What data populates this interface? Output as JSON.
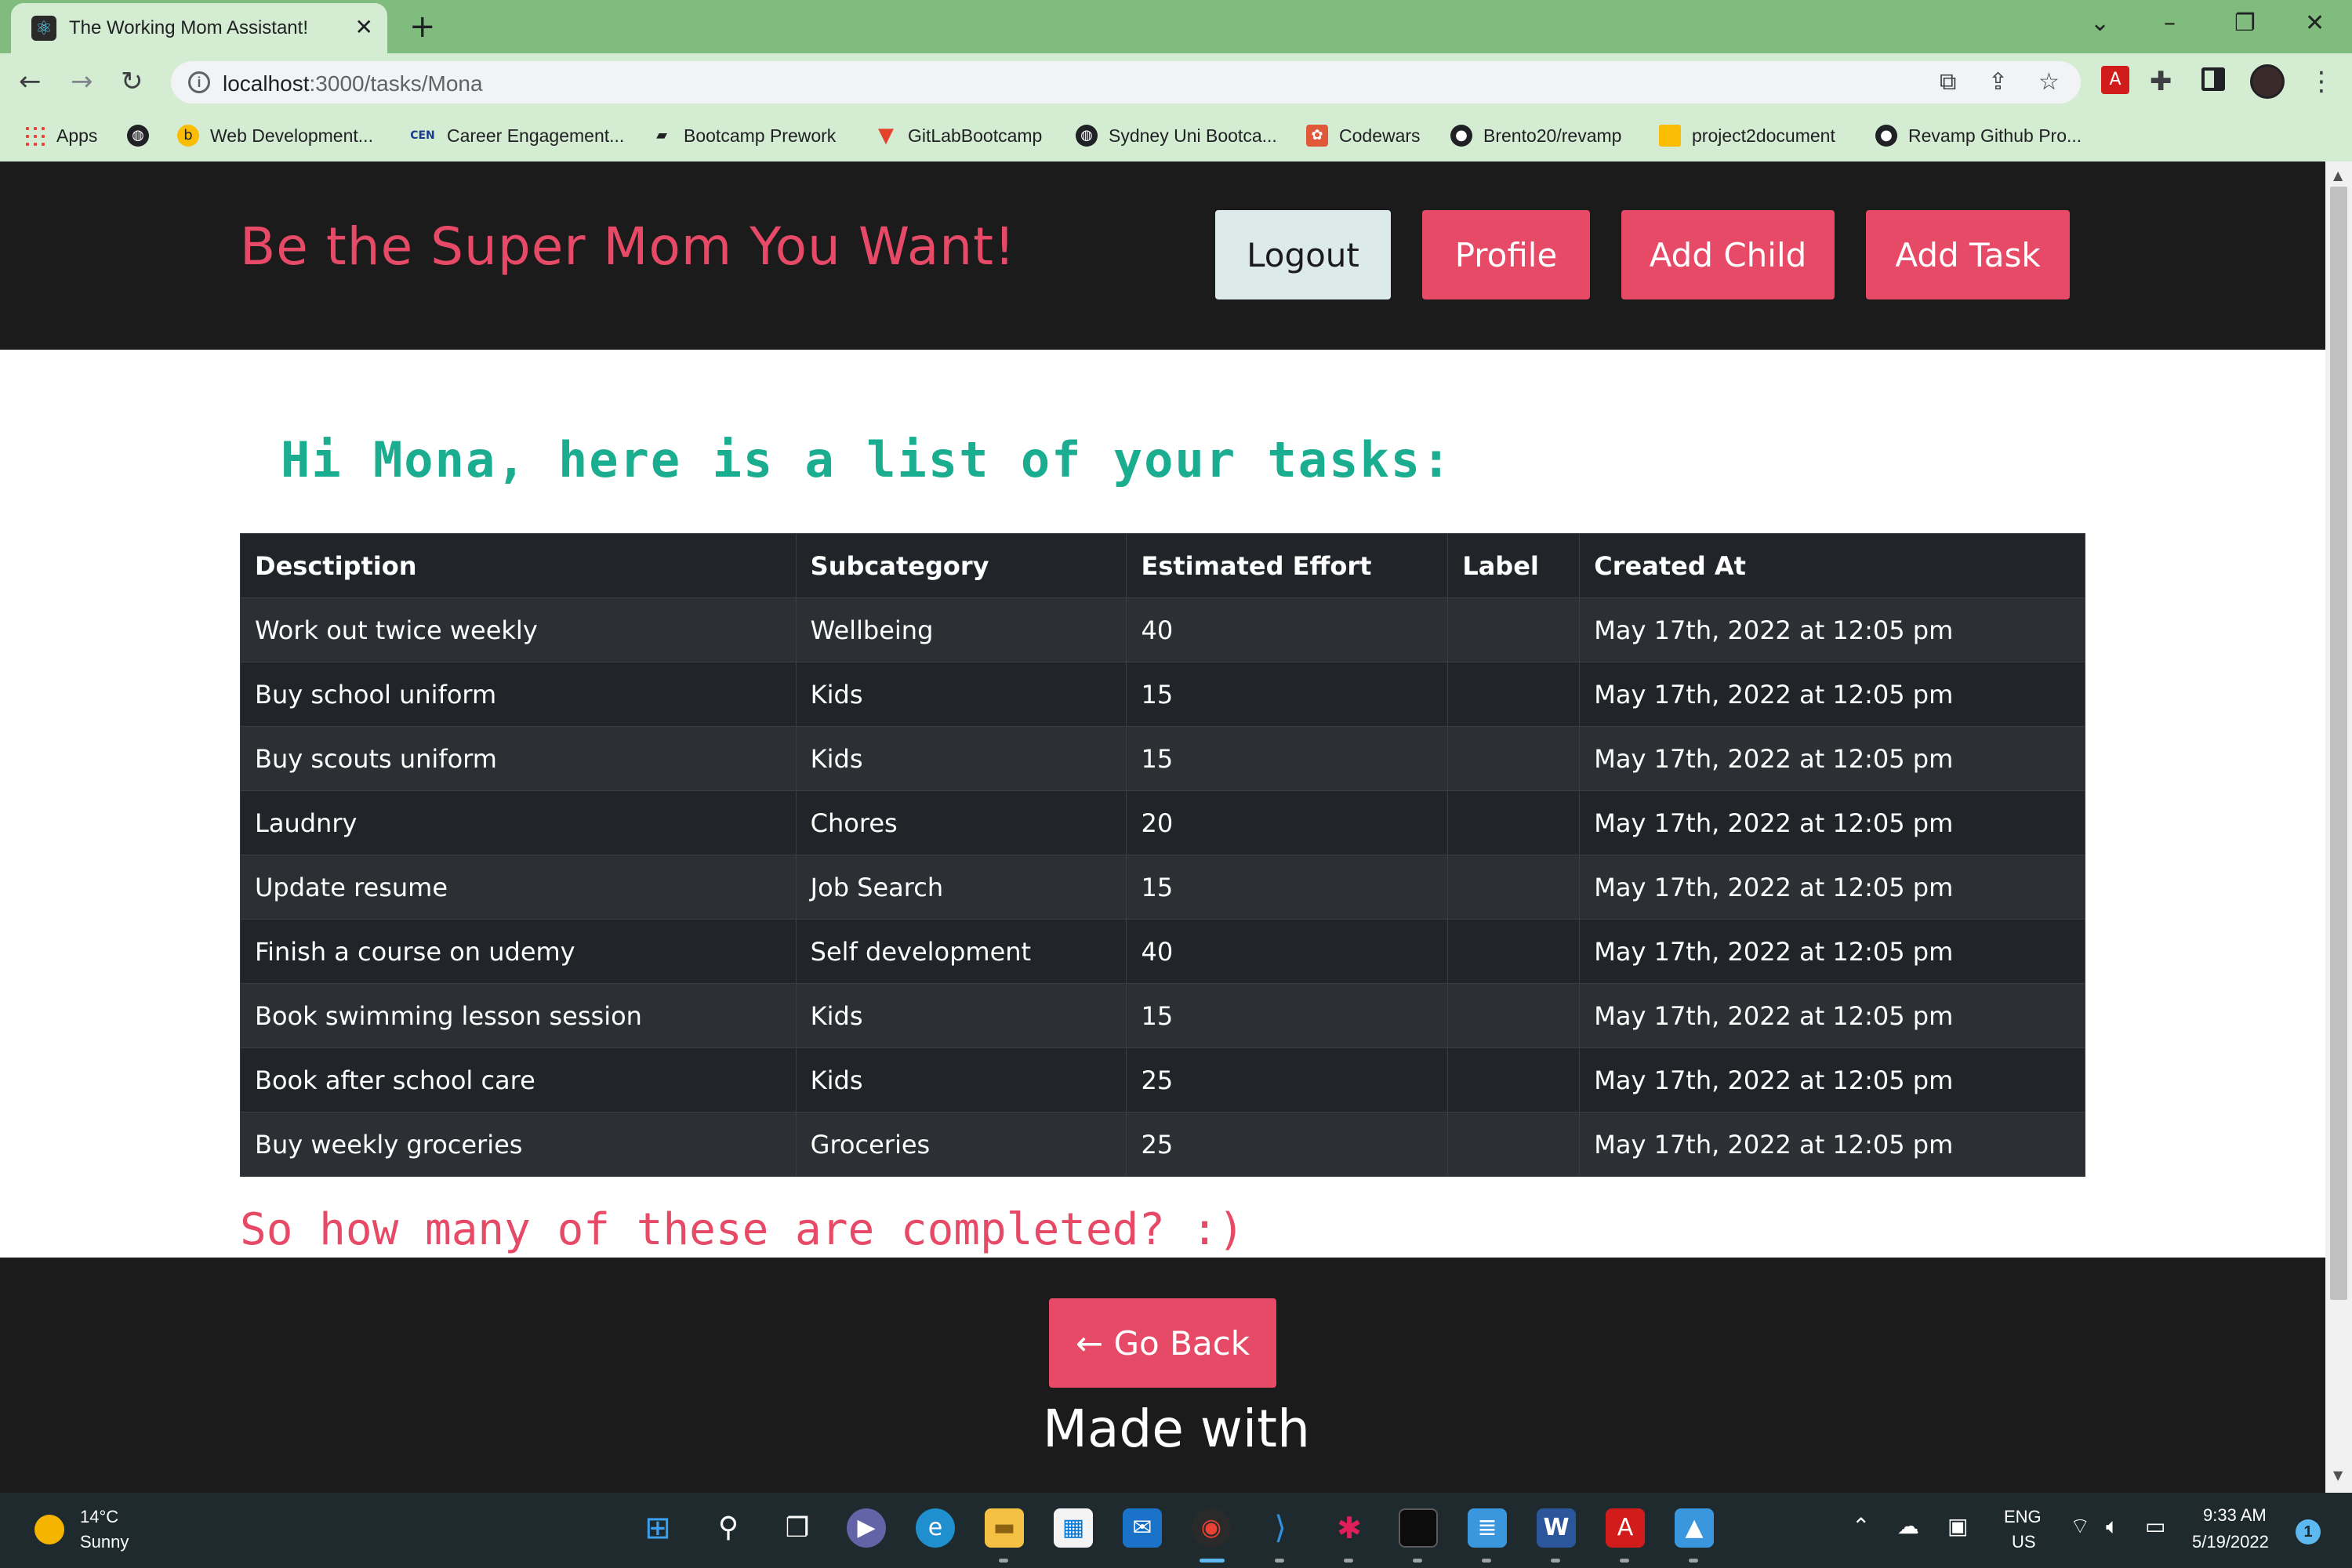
{
  "browser": {
    "tab_title": "The Working Mom Assistant!",
    "url_host": "localhost",
    "url_path": ":3000/tasks/Mona",
    "bookmarks": [
      {
        "label": "Apps"
      },
      {
        "label": ""
      },
      {
        "label": "Web Development..."
      },
      {
        "label": "Career Engagement..."
      },
      {
        "label": "Bootcamp Prework"
      },
      {
        "label": "GitLabBootcamp"
      },
      {
        "label": "Sydney Uni Bootca..."
      },
      {
        "label": "Codewars"
      },
      {
        "label": "Brento20/revamp"
      },
      {
        "label": "project2document"
      },
      {
        "label": "Revamp Github Pro..."
      }
    ]
  },
  "header": {
    "title": "Be the Super Mom You Want!",
    "buttons": {
      "logout": "Logout",
      "profile": "Profile",
      "add_child": "Add Child",
      "add_task": "Add Task"
    }
  },
  "main": {
    "greeting": "Hi Mona, here is a list of your tasks:",
    "table": {
      "headers": [
        "Desctiption",
        "Subcategory",
        "Estimated Effort",
        "Label",
        "Created At"
      ],
      "rows": [
        [
          "Work out twice weekly",
          "Wellbeing",
          "40",
          "",
          "May 17th, 2022 at 12:05 pm"
        ],
        [
          "Buy school uniform",
          "Kids",
          "15",
          "",
          "May 17th, 2022 at 12:05 pm"
        ],
        [
          "Buy scouts uniform",
          "Kids",
          "15",
          "",
          "May 17th, 2022 at 12:05 pm"
        ],
        [
          "Laudnry",
          "Chores",
          "20",
          "",
          "May 17th, 2022 at 12:05 pm"
        ],
        [
          "Update resume",
          "Job Search",
          "15",
          "",
          "May 17th, 2022 at 12:05 pm"
        ],
        [
          "Finish a course on udemy",
          "Self development",
          "40",
          "",
          "May 17th, 2022 at 12:05 pm"
        ],
        [
          "Book swimming lesson session",
          "Kids",
          "15",
          "",
          "May 17th, 2022 at 12:05 pm"
        ],
        [
          "Book after school care",
          "Kids",
          "25",
          "",
          "May 17th, 2022 at 12:05 pm"
        ],
        [
          "Buy weekly groceries",
          "Groceries",
          "25",
          "",
          "May 17th, 2022 at 12:05 pm"
        ]
      ]
    },
    "completed_question": "So how many of these are completed? :)"
  },
  "footer": {
    "back_label": "← Go Back",
    "made_with": "Made with"
  },
  "taskbar": {
    "temperature": "14°C",
    "weather": "Sunny",
    "lang_top": "ENG",
    "lang_bottom": "US",
    "time": "9:33 AM",
    "date": "5/19/2022",
    "notification_count": "1"
  },
  "colors": {
    "accent_pink": "#e64a66",
    "accent_teal": "#1aad8f",
    "header_bg": "#1b1b1c",
    "browser_green": "#7fbc7d"
  }
}
